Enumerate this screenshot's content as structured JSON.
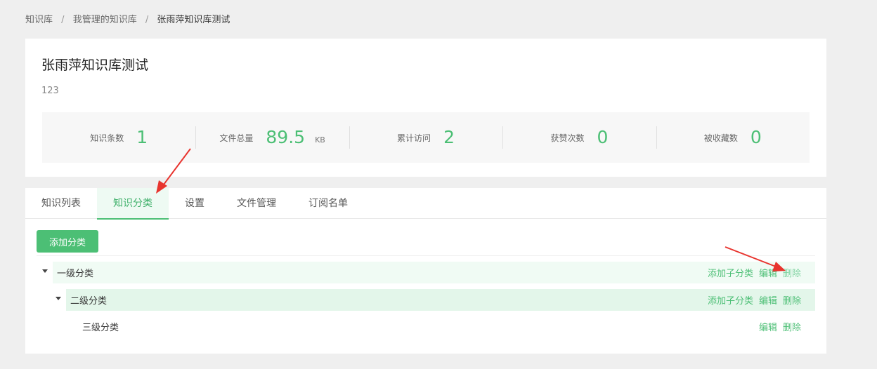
{
  "breadcrumb": {
    "items": [
      "知识库",
      "我管理的知识库",
      "张雨萍知识库测试"
    ],
    "separator": "/"
  },
  "kb": {
    "title": "张雨萍知识库测试",
    "description": "123"
  },
  "stats": [
    {
      "label": "知识条数",
      "value": "1",
      "unit": ""
    },
    {
      "label": "文件总量",
      "value": "89.5",
      "unit": "KB"
    },
    {
      "label": "累计访问",
      "value": "2",
      "unit": ""
    },
    {
      "label": "获赞次数",
      "value": "0",
      "unit": ""
    },
    {
      "label": "被收藏数",
      "value": "0",
      "unit": ""
    }
  ],
  "tabs": [
    {
      "label": "知识列表",
      "active": false
    },
    {
      "label": "知识分类",
      "active": true
    },
    {
      "label": "设置",
      "active": false
    },
    {
      "label": "文件管理",
      "active": false
    },
    {
      "label": "订阅名单",
      "active": false
    }
  ],
  "add_button": "添加分类",
  "tree": [
    {
      "level": 1,
      "label": "一级分类",
      "actions": {
        "add_child": "添加子分类",
        "edit": "编辑",
        "delete": "删除"
      }
    },
    {
      "level": 2,
      "label": "二级分类",
      "actions": {
        "add_child": "添加子分类",
        "edit": "编辑",
        "delete": "删除"
      }
    },
    {
      "level": 3,
      "label": "三级分类",
      "actions": {
        "edit": "编辑",
        "delete": "删除"
      }
    }
  ],
  "colors": {
    "accent": "#4cbf75",
    "annotation_arrow": "#e8342e",
    "background": "#efefef"
  }
}
